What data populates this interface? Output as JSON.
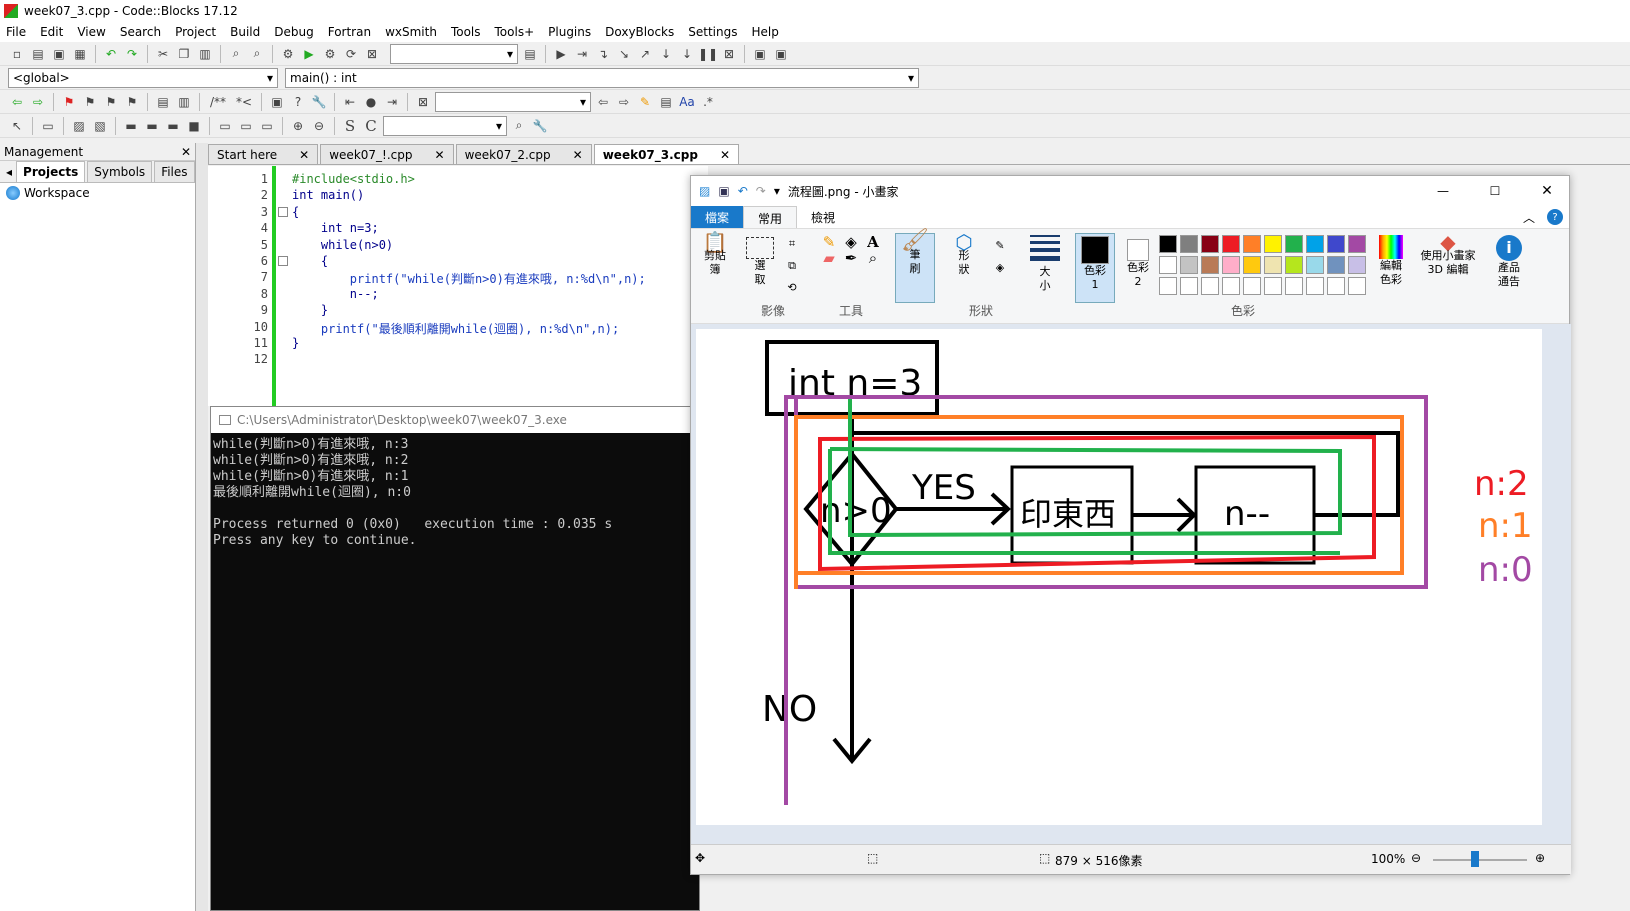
{
  "codeblocks": {
    "title": "week07_3.cpp - Code::Blocks 17.12",
    "menu": [
      "File",
      "Edit",
      "View",
      "Search",
      "Project",
      "Build",
      "Debug",
      "Fortran",
      "wxSmith",
      "Tools",
      "Tools+",
      "Plugins",
      "DoxyBlocks",
      "Settings",
      "Help"
    ],
    "scope_combo": "<global>",
    "function_combo": "main() : int",
    "doxy_comment1": "/**",
    "doxy_comment2": "*<",
    "management": {
      "title": "Management",
      "tabs": [
        "Projects",
        "Symbols",
        "Files"
      ],
      "workspace": "Workspace"
    },
    "editor_tabs": [
      "Start here",
      "week07_!.cpp",
      "week07_2.cpp",
      "week07_3.cpp"
    ],
    "code_lines": [
      "#include<stdio.h>",
      "int main()",
      "{",
      "    int n=3;",
      "    while(n>0)",
      "    {",
      "        printf(\"while(判斷n>0)有進來哦, n:%d\\n\",n);",
      "        n--;",
      "    }",
      "    printf(\"最後順利離開while(迴圈), n:%d\\n\",n);",
      "}",
      ""
    ]
  },
  "console": {
    "title": "C:\\Users\\Administrator\\Desktop\\week07\\week07_3.exe",
    "lines": [
      "while(判斷n>0)有進來哦, n:3",
      "while(判斷n>0)有進來哦, n:2",
      "while(判斷n>0)有進來哦, n:1",
      "最後順利離開while(迴圈), n:0",
      "",
      "Process returned 0 (0x0)   execution time : 0.035 s",
      "Press any key to continue."
    ]
  },
  "paint": {
    "title": "流程圖.png - 小畫家",
    "tabs": [
      "檔案",
      "常用",
      "檢視"
    ],
    "ribbon": {
      "clipboard": "剪貼簿",
      "select": "選取",
      "image_group": "影像",
      "tools_group": "工具",
      "brush": "筆刷",
      "shapes": "形狀",
      "shapes_group": "形狀",
      "size": "大小",
      "color1": "色彩 1",
      "color2": "色彩 2",
      "edit_colors": "編輯色彩",
      "paint3d": "使用小畫家 3D 編輯",
      "product_alert": "產品通告",
      "colors_group": "色彩"
    },
    "palette": [
      "#000000",
      "#7f7f7f",
      "#880015",
      "#ed1c24",
      "#ff7f27",
      "#fff200",
      "#22b14c",
      "#00a2e8",
      "#3f48cc",
      "#a349a4",
      "#ffffff",
      "#c3c3c3",
      "#b97a57",
      "#ffaec9",
      "#ffc90e",
      "#efe4b0",
      "#b5e61d",
      "#99d9ea",
      "#7092be",
      "#c8bfe7"
    ],
    "drawing": {
      "init_box": "int n=3",
      "condition": "n>0",
      "yes_label": "YES",
      "print_box": "印東西",
      "dec_box": "n--",
      "no_label": "NO",
      "n2": "n:2",
      "n1": "n:1",
      "n0": "n:0",
      "colors": {
        "black": "#000000",
        "purple": "#a349a4",
        "orange": "#ff7f27",
        "red": "#ed1c24",
        "green": "#22b14c"
      }
    },
    "status": {
      "dimensions": "879 × 516像素",
      "zoom": "100%"
    }
  }
}
